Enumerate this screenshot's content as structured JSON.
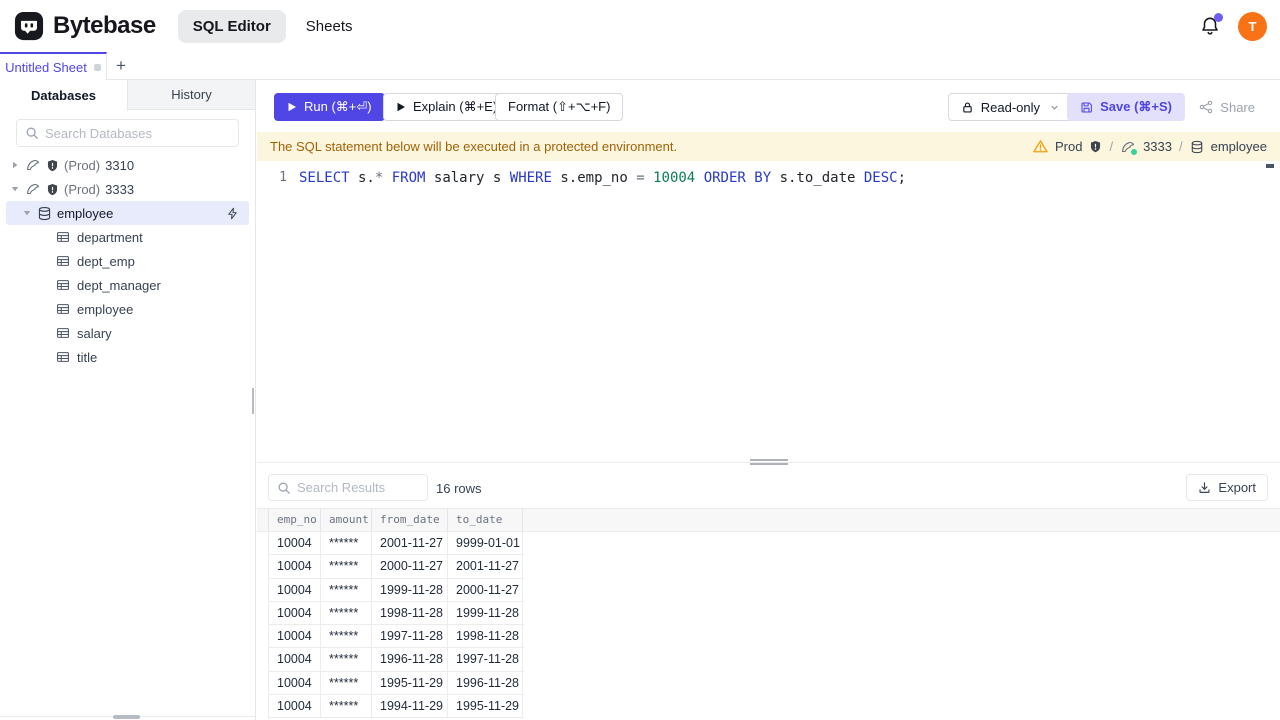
{
  "colors": {
    "accent": "#4f46e5",
    "avatar_bg": "#f97316",
    "banner_bg": "#fcf6de",
    "banner_text": "#a16207",
    "warning": "#f59e0b",
    "instance_status": "#34d399",
    "selected_row_bg": "#e8ebfb",
    "keyword": "#2838c8",
    "number_literal": "#0a7d54"
  },
  "header": {
    "brand": "Bytebase",
    "nav_sql_editor": "SQL Editor",
    "nav_sheets": "Sheets",
    "avatar": "T"
  },
  "sheet_tabs": {
    "active": "Untitled Sheet",
    "add": "+"
  },
  "sidebar": {
    "tab_databases": "Databases",
    "tab_history": "History",
    "search_placeholder": "Search Databases",
    "instances": [
      {
        "env": "(Prod)",
        "name": "3310"
      },
      {
        "env": "(Prod)",
        "name": "3333"
      }
    ],
    "database": "employee",
    "tables": [
      "department",
      "dept_emp",
      "dept_manager",
      "employee",
      "salary",
      "title"
    ]
  },
  "toolbar": {
    "run": "Run (⌘+⏎)",
    "explain": "Explain (⌘+E)",
    "format": "Format (⇧+⌥+F)",
    "readonly": "Read-only",
    "save": "Save (⌘+S)",
    "share": "Share"
  },
  "banner": {
    "message": "The SQL statement below will be executed in a protected environment.",
    "env": "Prod",
    "sep": "/",
    "instance": "3333",
    "database": "employee"
  },
  "editor": {
    "line_number": "1",
    "tokens": [
      {
        "t": "SELECT",
        "c": "kw"
      },
      {
        "t": " s.",
        "c": "pl"
      },
      {
        "t": "*",
        "c": "op"
      },
      {
        "t": " ",
        "c": "pl"
      },
      {
        "t": "FROM",
        "c": "kw"
      },
      {
        "t": " salary s ",
        "c": "pl"
      },
      {
        "t": "WHERE",
        "c": "kw"
      },
      {
        "t": " s.emp_no ",
        "c": "pl"
      },
      {
        "t": "=",
        "c": "op"
      },
      {
        "t": " ",
        "c": "pl"
      },
      {
        "t": "10004",
        "c": "num"
      },
      {
        "t": " ",
        "c": "pl"
      },
      {
        "t": "ORDER",
        "c": "kw"
      },
      {
        "t": " ",
        "c": "pl"
      },
      {
        "t": "BY",
        "c": "kw"
      },
      {
        "t": " s.to_date ",
        "c": "pl"
      },
      {
        "t": "DESC",
        "c": "kw"
      },
      {
        "t": ";",
        "c": "pl"
      }
    ]
  },
  "results": {
    "search_placeholder": "Search Results",
    "row_count": "16 rows",
    "export": "Export",
    "columns": [
      "emp_no",
      "amount",
      "from_date",
      "to_date"
    ],
    "rows": [
      [
        "10004",
        "******",
        "2001-11-27",
        "9999-01-01"
      ],
      [
        "10004",
        "******",
        "2000-11-27",
        "2001-11-27"
      ],
      [
        "10004",
        "******",
        "1999-11-28",
        "2000-11-27"
      ],
      [
        "10004",
        "******",
        "1998-11-28",
        "1999-11-28"
      ],
      [
        "10004",
        "******",
        "1997-11-28",
        "1998-11-28"
      ],
      [
        "10004",
        "******",
        "1996-11-28",
        "1997-11-28"
      ],
      [
        "10004",
        "******",
        "1995-11-29",
        "1996-11-28"
      ],
      [
        "10004",
        "******",
        "1994-11-29",
        "1995-11-29"
      ]
    ]
  }
}
